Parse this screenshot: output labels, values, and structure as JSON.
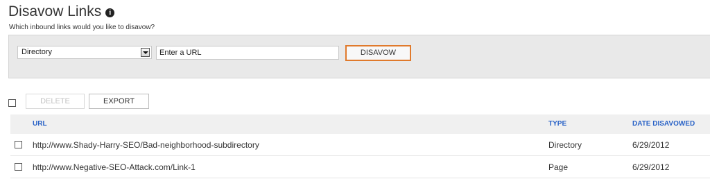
{
  "header": {
    "title": "Disavow Links",
    "info_icon": "info-icon",
    "subtitle": "Which inbound links would you like to disavow?"
  },
  "form": {
    "type_select_value": "Directory",
    "url_placeholder": "Enter a URL",
    "disavow_label": "DISAVOW"
  },
  "colors": {
    "accent_border": "#e07a2c",
    "header_link": "#2a63c7",
    "panel_bg": "#e9e9e9"
  },
  "toolbar": {
    "delete_label": "DELETE",
    "export_label": "EXPORT"
  },
  "table": {
    "columns": [
      "URL",
      "TYPE",
      "DATE DISAVOWED"
    ],
    "rows": [
      {
        "url": "http://www.Shady-Harry-SEO/Bad-neighborhood-subdirectory",
        "type": "Directory",
        "date": "6/29/2012"
      },
      {
        "url": "http://www.Negative-SEO-Attack.com/Link-1",
        "type": "Page",
        "date": "6/29/2012"
      }
    ]
  }
}
